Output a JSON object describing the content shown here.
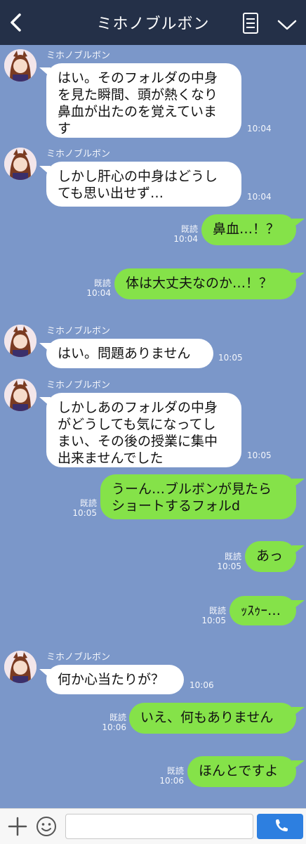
{
  "header": {
    "title": "ミホノブルボン",
    "back_icon": "chevron-left-icon",
    "note_icon": "notes-icon",
    "menu_icon": "chevron-down-icon",
    "bg": "#243048"
  },
  "chat": {
    "bg": "#7b97c9",
    "incoming_bubble_color": "#ffffff",
    "outgoing_bubble_color": "#85e249",
    "messages": [
      {
        "dir": "in",
        "sender": "ミホノブルボン",
        "lines": [
          "はい。そのフォルダの中身",
          "を見た瞬間、頭が熱くなり",
          "鼻血が出たのを覚えていま",
          "す"
        ],
        "time": "10:04"
      },
      {
        "dir": "in",
        "sender": "ミホノブルボン",
        "lines": [
          "しかし肝心の中身はどうし",
          "ても思い出せず…"
        ],
        "time": "10:04"
      },
      {
        "dir": "out",
        "read": "既読",
        "lines": [
          "鼻血…！？"
        ],
        "time": "10:04"
      },
      {
        "dir": "out",
        "read": "既読",
        "lines": [
          "体は大丈夫なのか…！？"
        ],
        "time": "10:04"
      },
      {
        "dir": "in",
        "sender": "ミホノブルボン",
        "lines": [
          "はい。問題ありません"
        ],
        "time": "10:05"
      },
      {
        "dir": "in",
        "sender": "ミホノブルボン",
        "lines": [
          "しかしあのフォルダの中身",
          "がどうしても気になってし",
          "まい、その後の授業に集中",
          "出来ませんでした"
        ],
        "time": "10:05"
      },
      {
        "dir": "out",
        "read": "既読",
        "lines": [
          "うーん…ブルボンが見たら",
          "ショートするフォルd"
        ],
        "time": "10:05"
      },
      {
        "dir": "out",
        "read": "既読",
        "lines": [
          "あっ"
        ],
        "time": "10:05"
      },
      {
        "dir": "out",
        "read": "既読",
        "lines": [
          "ｯｽｩｰ…"
        ],
        "time": "10:05"
      },
      {
        "dir": "in",
        "sender": "ミホノブルボン",
        "lines": [
          "何か心当たりが？"
        ],
        "time": "10:06"
      },
      {
        "dir": "out",
        "read": "既読",
        "lines": [
          "いえ、何もありません"
        ],
        "time": "10:06"
      },
      {
        "dir": "out",
        "read": "既読",
        "lines": [
          "ほんとですよ"
        ],
        "time": "10:06"
      }
    ]
  },
  "footer": {
    "plus_icon": "plus-icon",
    "emoji_icon": "smiley-icon",
    "input_value": "",
    "call_icon": "phone-icon",
    "call_color": "#2d7fe0"
  }
}
